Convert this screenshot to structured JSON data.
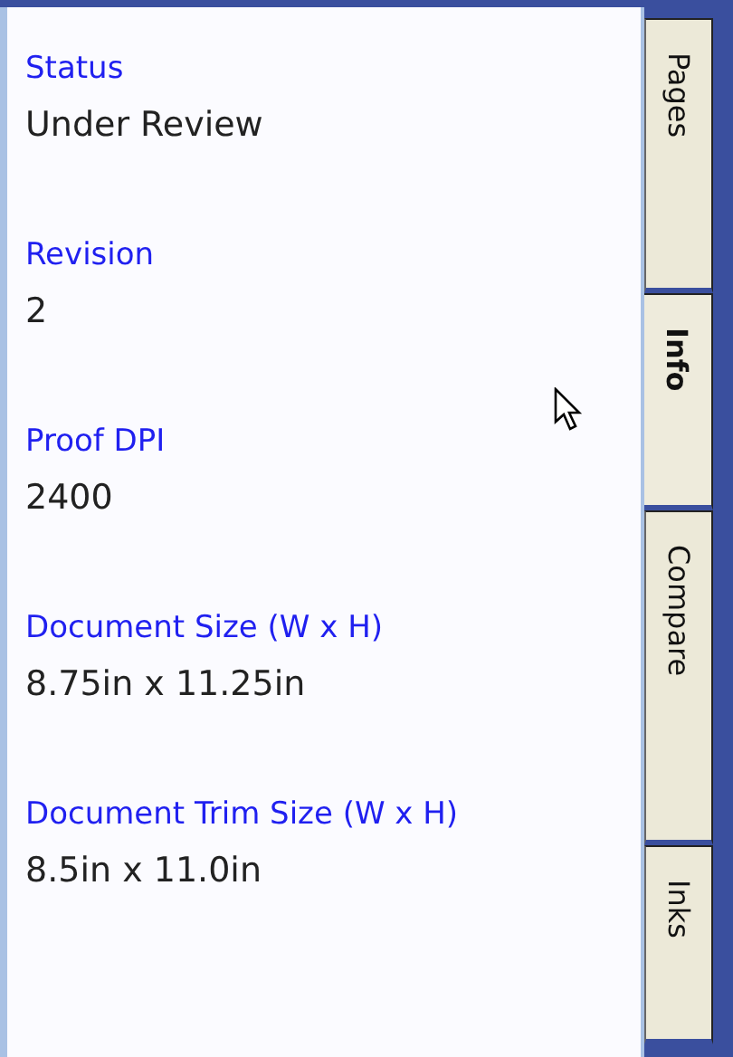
{
  "fields": [
    {
      "label": "Status",
      "value": "Under Review"
    },
    {
      "label": "Revision",
      "value": "2"
    },
    {
      "label": "Proof DPI",
      "value": "2400"
    },
    {
      "label": "Document Size (W x H)",
      "value": "8.75in x 11.25in"
    },
    {
      "label": "Document Trim Size (W x H)",
      "value": "8.5in x 11.0in"
    }
  ],
  "tabs": [
    {
      "label": "Pages",
      "selected": false
    },
    {
      "label": "Info",
      "selected": true
    },
    {
      "label": "Compare",
      "selected": false
    },
    {
      "label": "Inks",
      "selected": false
    }
  ]
}
